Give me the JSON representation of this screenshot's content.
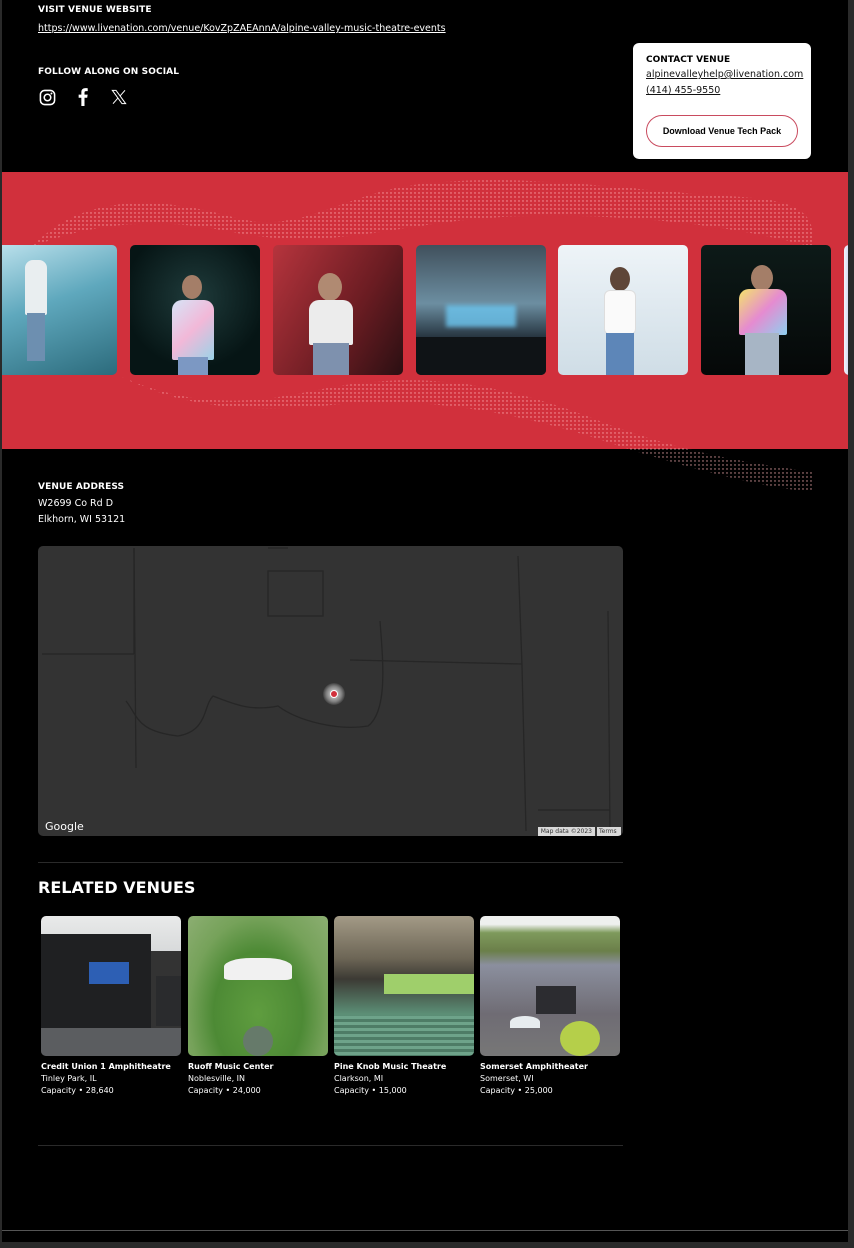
{
  "website": {
    "label": "VISIT VENUE WEBSITE",
    "url": "https://www.livenation.com/venue/KovZpZAEAnnA/alpine-valley-music-theatre-events"
  },
  "social": {
    "label": "FOLLOW ALONG ON SOCIAL",
    "icons": [
      "instagram-icon",
      "facebook-icon",
      "x-icon"
    ]
  },
  "contact": {
    "title": "CONTACT VENUE",
    "email": "alpinevalleyhelp@livenation.com",
    "phone": "(414) 455-9550",
    "tech_pack_button": "Download Venue Tech Pack"
  },
  "gallery": {
    "background_color": "#d1303c",
    "photos": [
      "Performer in white shirt on misty blue stage",
      "Performer in tie-dye shirt raising hand",
      "Performer singing into microphone, red backdrop",
      "Amphitheatre interior with crowd and stage lights",
      "Performer singing on bright white stage",
      "Performer in tie-dye shirt laughing",
      "Partial photo"
    ]
  },
  "address": {
    "label": "VENUE ADDRESS",
    "line1": "W2699 Co Rd D",
    "line2": "Elkhorn, WI 53121"
  },
  "map": {
    "logo": "Google",
    "attribution": "Map data ©2023",
    "terms": "Terms",
    "pin_color": "#d1303c"
  },
  "related": {
    "title": "RELATED VENUES",
    "venues": [
      {
        "name": "Credit Union 1 Amphitheatre",
        "location": "Tinley Park, IL",
        "capacity": "Capacity • 28,640"
      },
      {
        "name": "Ruoff Music Center",
        "location": "Noblesville, IN",
        "capacity": "Capacity • 24,000"
      },
      {
        "name": "Pine Knob Music Theatre",
        "location": "Clarkson, MI",
        "capacity": "Capacity • 15,000"
      },
      {
        "name": "Somerset Amphitheater",
        "location": "Somerset, WI",
        "capacity": "Capacity • 25,000"
      }
    ]
  }
}
